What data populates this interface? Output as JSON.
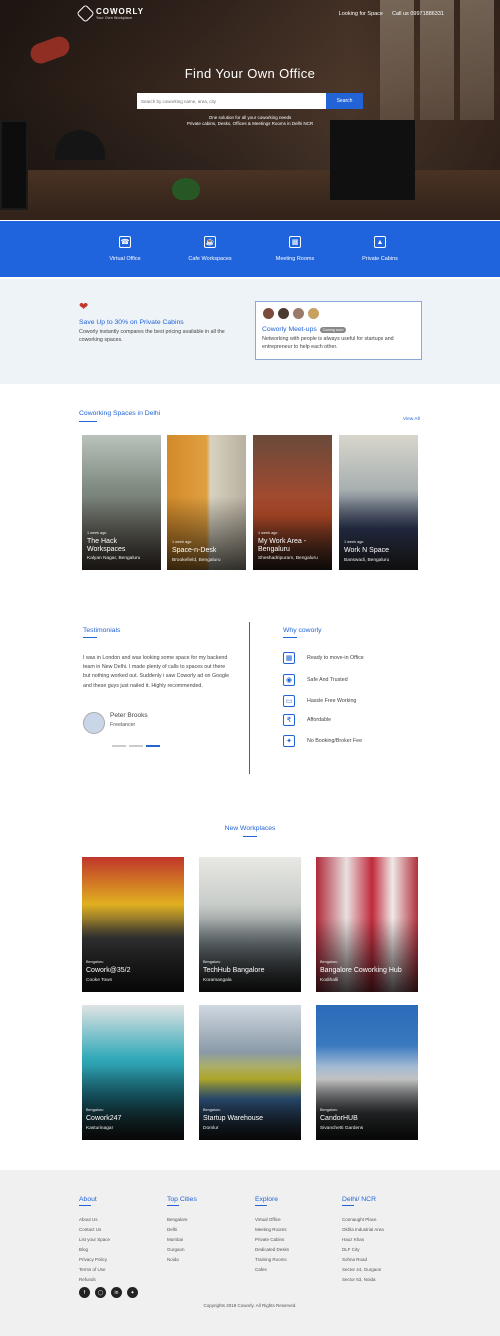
{
  "brand": {
    "name": "COWORLY",
    "tagline": "Your Own Workplace"
  },
  "nav": {
    "looking": "Looking for Space",
    "call": "Call us 09971886331"
  },
  "hero": {
    "title": "Find Your Own Office",
    "search_placeholder": "Search by coworking name, area, city",
    "search_button": "Search",
    "tagline1": "One solution for all your coworking needs",
    "tagline2": "Private cabins, Desks, Offices & Meetings Rooms in Delhi NCR"
  },
  "categories": [
    {
      "label": "Virtual Office",
      "icon": "phone-icon"
    },
    {
      "label": "Cafe Workspaces",
      "icon": "coffee-cup-icon"
    },
    {
      "label": "Meeting Rooms",
      "icon": "meeting-table-icon"
    },
    {
      "label": "Private Cabins",
      "icon": "chair-icon"
    }
  ],
  "promo": {
    "title": "Save Up to 30% on Private Cabins",
    "desc": "Coworly instantly compares the best pricing available in all the coworking spaces."
  },
  "meetups": {
    "title": "Coworly Meet-ups",
    "badge": "Coming soon",
    "desc": "Networking with people is always useful for startups and entrepreneur to help each other."
  },
  "spaces": {
    "title": "Coworking Spaces in Delhi",
    "view_all": "View All",
    "items": [
      {
        "when": "1 week ago",
        "name1": "The Hack",
        "name2": "Workspaces",
        "loc": "Kalyan Nagar, Bengaluru",
        "bg": "#8a8f86"
      },
      {
        "when": "1 week ago",
        "name1": "Space-n-Desk",
        "name2": "",
        "loc": "Brookefield, Bengaluru",
        "bg": "#c08a3a"
      },
      {
        "when": "1 week ago",
        "name1": "My Work Area -",
        "name2": "Bengaluru",
        "loc": "Sheshadripuram, Bengaluru",
        "bg": "#9a4a2a"
      },
      {
        "when": "1 week ago",
        "name1": "Work N Space",
        "name2": "",
        "loc": "Banswadi, Bengaluru",
        "bg": "#5c6a78"
      }
    ]
  },
  "testimonials": {
    "title": "Testimonials",
    "quote": "I was in London and was looking some space for my backend team in New Delhi. I made plenty of calls to spaces out there but nothing worked out. Suddenly i saw Coworly ad on Google and these guys just nailed it. Highly recommended.",
    "name": "Peter Brooks",
    "role": "Freelancer"
  },
  "why": {
    "title": "Why coworly",
    "items": [
      {
        "label": "Ready to move-in Office",
        "icon": "building-icon"
      },
      {
        "label": "Safe And Trusted",
        "icon": "lock-icon"
      },
      {
        "label": "Hassle Free Working",
        "icon": "laptop-icon"
      },
      {
        "label": "Affordable",
        "icon": "money-icon"
      },
      {
        "label": "No Booking/Broker Fee",
        "icon": "network-icon"
      }
    ]
  },
  "workplaces": {
    "title": "New Workplaces",
    "items": [
      {
        "city": "Bengaluru",
        "name": "Cowork@35/2",
        "loc": "Cooke Town",
        "bg": "#c9a21a"
      },
      {
        "city": "Bengaluru",
        "name": "TechHub Bangalore",
        "loc": "Koramangala",
        "bg": "#7c8280"
      },
      {
        "city": "Bengaluru",
        "name": "Bangalore Coworking Hub",
        "loc": "Kodihalli",
        "bg": "#8a2f3a"
      },
      {
        "city": "Bengaluru",
        "name": "Cowork247",
        "loc": "Kasturinagar",
        "bg": "#2a9fb0"
      },
      {
        "city": "Bengaluru",
        "name": "Startup Warehouse",
        "loc": "Domlur",
        "bg": "#8a9aa8"
      },
      {
        "city": "Bengaluru",
        "name": "CandorHUB",
        "loc": "Sivanchetti Gardens",
        "bg": "#3a6ea8"
      }
    ]
  },
  "footer": {
    "about": {
      "title": "About",
      "links": [
        "About Us",
        "Contact Us",
        "List your Space",
        "Blog",
        "Privacy Policy",
        "Terms of Use",
        "Refunds"
      ]
    },
    "cities": {
      "title": "Top Cities",
      "links": [
        "Bengalore",
        "Delhi",
        "Mumbai",
        "Gurgaon",
        "Noida"
      ]
    },
    "explore": {
      "title": "Explore",
      "links": [
        "Virtual Office",
        "Meeting Rooms",
        "Private Cabins",
        "Dedicated Desks",
        "Training Rooms",
        "Cafes"
      ]
    },
    "ncr": {
      "title": "Delhi/ NCR",
      "links": [
        "Connaught Place",
        "Okhla Industrial Area",
        "Hauz Khas",
        "DLF City",
        "Sohna Road",
        "Sector 44, Gurgaon",
        "Sector 63, Noida"
      ]
    },
    "socials": [
      "facebook-icon",
      "instagram-icon",
      "linkedin-icon",
      "twitter-icon"
    ],
    "copyright": "Copyrights 2018 Coworly. All Rights Reserved."
  },
  "colors": {
    "accent": "#2264d6",
    "cat_bar": "#1f64dc",
    "promo_bg": "#eef3f8",
    "footer_bg": "#f0f0f0"
  }
}
